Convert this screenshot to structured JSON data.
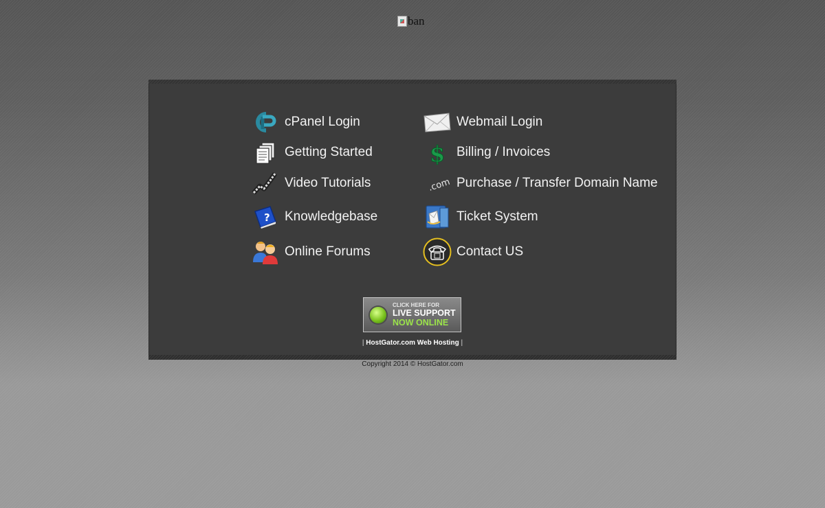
{
  "banner": {
    "alt": "ban"
  },
  "menu": {
    "left": [
      {
        "label": "cPanel Login",
        "icon": "cpanel-icon"
      },
      {
        "label": "Getting Started",
        "icon": "documents-icon"
      },
      {
        "label": "Video Tutorials",
        "icon": "film-strip-icon"
      },
      {
        "label": "Knowledgebase",
        "icon": "help-book-icon"
      },
      {
        "label": "Online Forums",
        "icon": "users-icon"
      }
    ],
    "right": [
      {
        "label": "Webmail Login",
        "icon": "envelope-icon"
      },
      {
        "label": "Billing / Invoices",
        "icon": "dollar-icon"
      },
      {
        "label": "Purchase / Transfer Domain Name",
        "icon": "dotcom-icon"
      },
      {
        "label": "Ticket System",
        "icon": "ticket-icon"
      },
      {
        "label": "Contact US",
        "icon": "phone-icon"
      }
    ]
  },
  "live_support": {
    "line1": "CLICK HERE FOR",
    "line2": "LIVE SUPPORT",
    "line3": "NOW ONLINE"
  },
  "footer": {
    "link_text": "HostGator.com Web Hosting",
    "separator": "|",
    "copyright": "Copyright 2014 © HostGator.com"
  },
  "colors": {
    "panel": "#3c3c3c",
    "text": "#f2f2f2",
    "live_green": "#9be34a"
  }
}
